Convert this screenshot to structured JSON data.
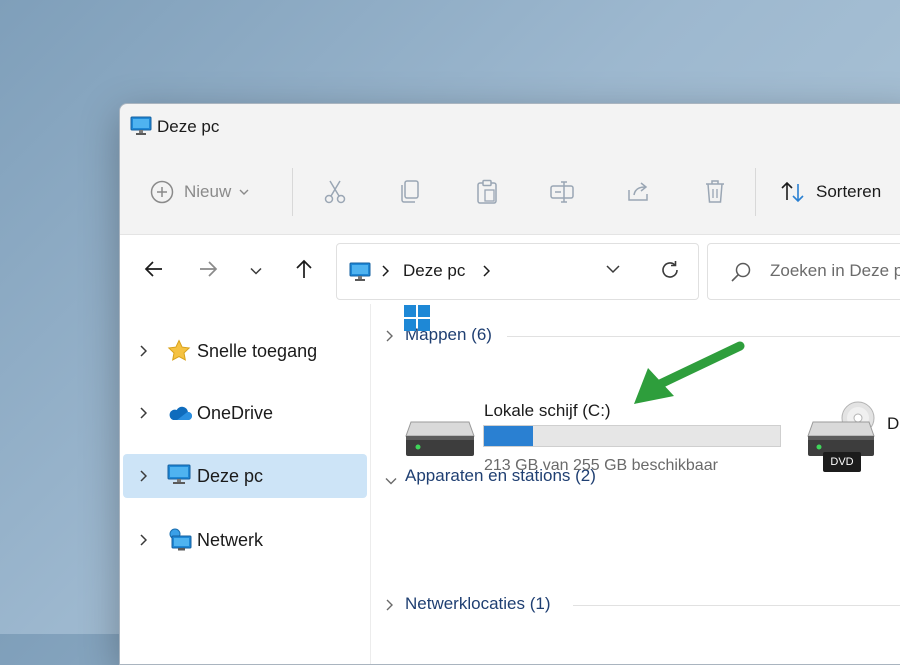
{
  "window": {
    "title": "Deze pc"
  },
  "toolbar": {
    "new_label": "Nieuw",
    "sort_label": "Sorteren"
  },
  "address": {
    "location": "Deze pc"
  },
  "search": {
    "placeholder": "Zoeken in Deze pc"
  },
  "sidebar": {
    "items": [
      {
        "label": "Snelle toegang",
        "icon": "star-icon"
      },
      {
        "label": "OneDrive",
        "icon": "cloud-icon"
      },
      {
        "label": "Deze pc",
        "icon": "monitor-icon",
        "selected": true
      },
      {
        "label": "Netwerk",
        "icon": "network-icon"
      }
    ]
  },
  "content": {
    "groups": [
      {
        "label": "Mappen (6)",
        "expanded": false
      },
      {
        "label": "Apparaten en stations (2)",
        "expanded": true
      },
      {
        "label": "Netwerklocaties (1)",
        "expanded": false
      }
    ],
    "drives": [
      {
        "name": "Lokale schijf (C:)",
        "usage_text": "213 GB van 255 GB beschikbaar",
        "used_fraction": 0.165
      },
      {
        "name": "D",
        "badge": "DVD"
      }
    ]
  },
  "colors": {
    "accent": "#2a80d2",
    "selection": "#cde4f7",
    "group_text": "#1f3f72",
    "annotation_arrow": "#2e9e3c"
  }
}
